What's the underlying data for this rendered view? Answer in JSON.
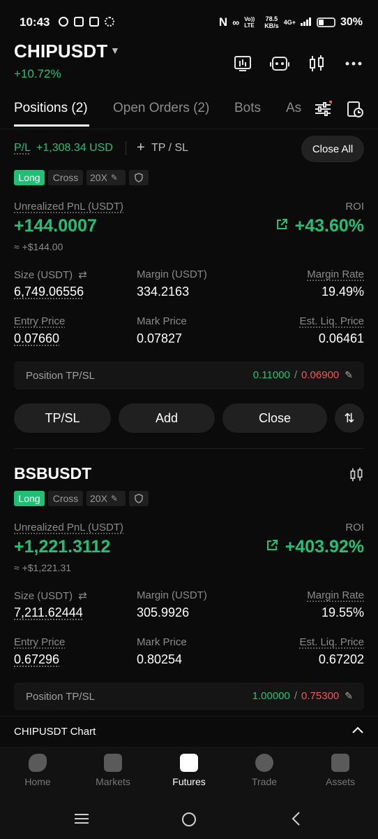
{
  "status_bar": {
    "time": "10:43",
    "net_speed_value": "78.5",
    "net_speed_unit": "KB/s",
    "network": "4G+",
    "volte": "Vo)) LTE",
    "battery": "30%"
  },
  "header": {
    "symbol": "CHIPUSDT",
    "change": "+10.72%"
  },
  "tabs": {
    "positions": "Positions (2)",
    "open_orders": "Open Orders (2)",
    "bots": "Bots",
    "assets_partial": "As"
  },
  "pnl_bar": {
    "pl_label": "P/L",
    "pl_value": "+1,308.34 USD",
    "tpsl_label": "TP / SL",
    "close_all": "Close All"
  },
  "position1": {
    "side": "Long",
    "margin_mode": "Cross",
    "leverage": "20X",
    "unrealized_label": "Unrealized PnL (USDT)",
    "unrealized_value": "+144.0007",
    "unrealized_usd": "≈ +$144.00",
    "roi_label": "ROI",
    "roi_value": "+43.60%",
    "size_label": "Size (USDT)",
    "size_value": "6,749.06556",
    "margin_label": "Margin (USDT)",
    "margin_value": "334.2163",
    "margin_rate_label": "Margin Rate",
    "margin_rate_value": "19.49%",
    "entry_label": "Entry Price",
    "entry_value": "0.07660",
    "mark_label": "Mark Price",
    "mark_value": "0.07827",
    "liq_label": "Est. Liq. Price",
    "liq_value": "0.06461",
    "tpsl_label": "Position TP/SL",
    "tp_value": "0.11000",
    "sl_value": "0.06900",
    "slash": "/"
  },
  "actions": {
    "tpsl": "TP/SL",
    "add": "Add",
    "close": "Close"
  },
  "position2": {
    "symbol": "BSBUSDT",
    "side": "Long",
    "margin_mode": "Cross",
    "leverage": "20X",
    "unrealized_label": "Unrealized PnL (USDT)",
    "unrealized_value": "+1,221.3112",
    "unrealized_usd": "≈ +$1,221.31",
    "roi_label": "ROI",
    "roi_value": "+403.92%",
    "size_label": "Size (USDT)",
    "size_value": "7,211.62444",
    "margin_label": "Margin (USDT)",
    "margin_value": "305.9926",
    "margin_rate_label": "Margin Rate",
    "margin_rate_value": "19.55%",
    "entry_label": "Entry Price",
    "entry_value": "0.67296",
    "mark_label": "Mark Price",
    "mark_value": "0.80254",
    "liq_label": "Est. Liq. Price",
    "liq_value": "0.67202",
    "tpsl_label": "Position TP/SL",
    "tp_value": "1.00000",
    "sl_value": "0.75300",
    "slash": "/"
  },
  "chart_bar": {
    "label": "CHIPUSDT Chart"
  },
  "bottom_nav": {
    "home": "Home",
    "markets": "Markets",
    "futures": "Futures",
    "trade": "Trade",
    "assets": "Assets"
  },
  "colors": {
    "green": "#21c17a",
    "red": "#f0575c",
    "orange": "#f7a33a",
    "background": "#0b0b0b"
  }
}
